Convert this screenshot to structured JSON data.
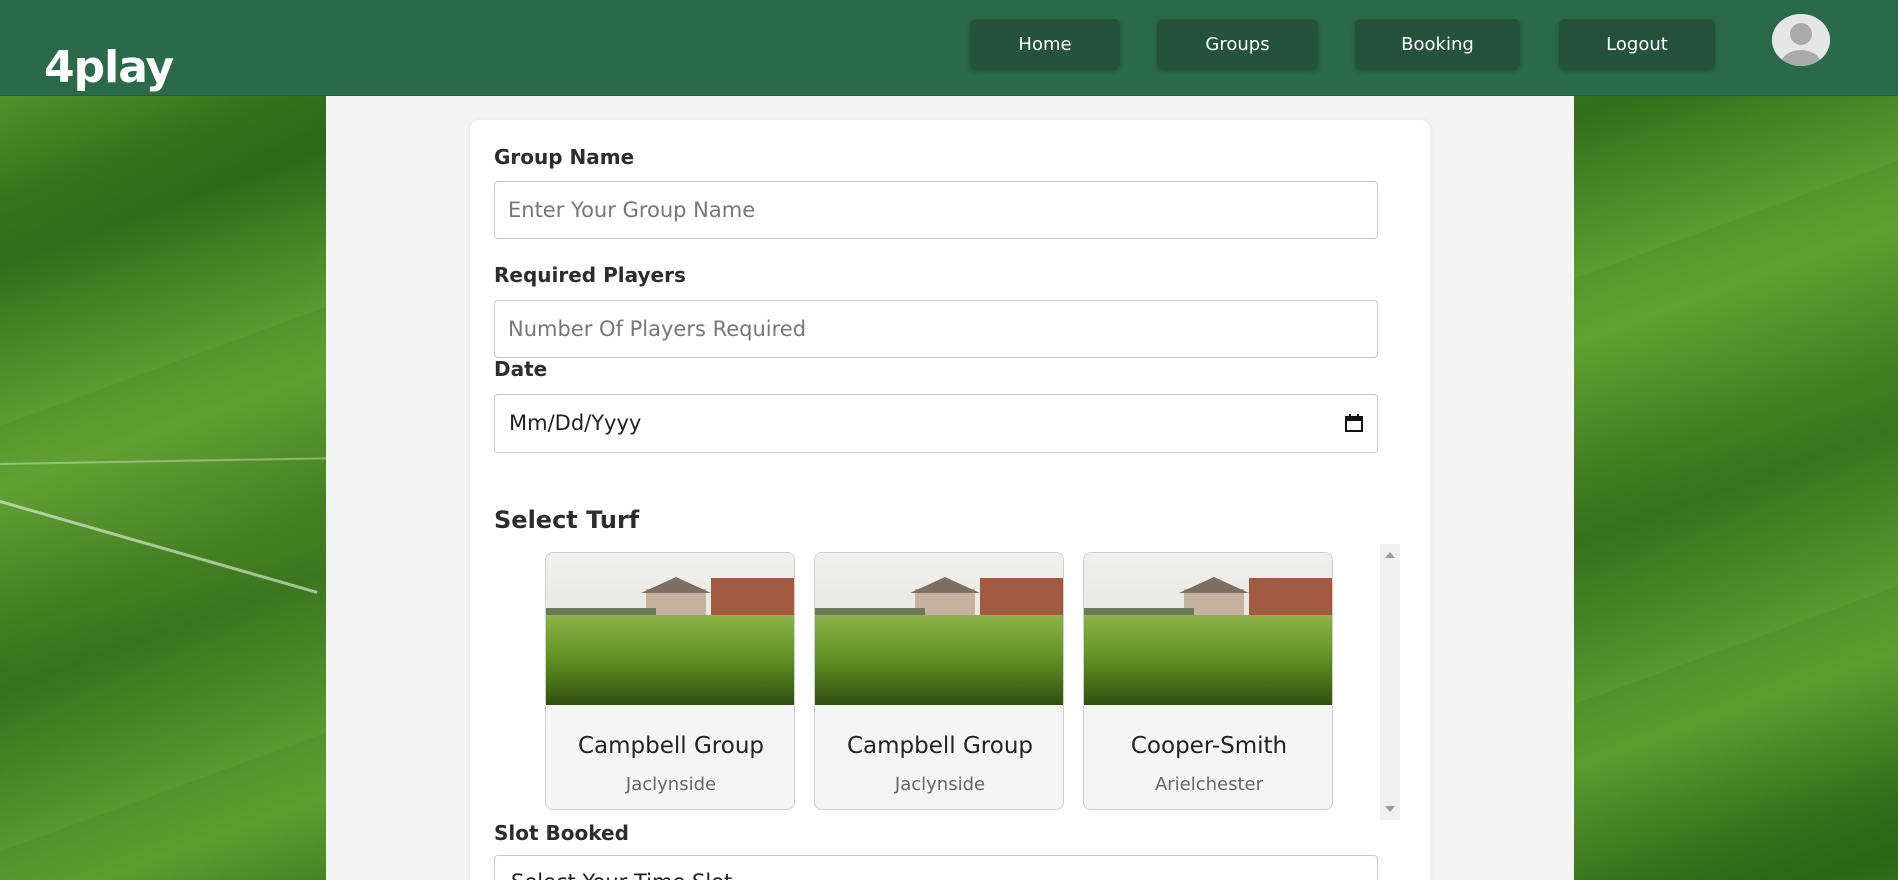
{
  "app": {
    "logo": "4play"
  },
  "nav": {
    "items": [
      {
        "label": "Home"
      },
      {
        "label": "Groups"
      },
      {
        "label": "Booking"
      },
      {
        "label": "Logout"
      }
    ]
  },
  "form": {
    "group_name": {
      "label": "Group Name",
      "placeholder": "Enter Your Group Name"
    },
    "required_players": {
      "label": "Required Players",
      "placeholder": "Number Of Players Required"
    },
    "date": {
      "label": "Date",
      "placeholder": "Mm/Dd/Yyyy"
    },
    "select_turf": {
      "title": "Select Turf"
    },
    "turfs": [
      {
        "name": "Campbell Group",
        "location": "Jaclynside"
      },
      {
        "name": "Campbell Group",
        "location": "Jaclynside"
      },
      {
        "name": "Cooper-Smith",
        "location": "Arielchester"
      }
    ],
    "slot": {
      "label": "Slot Booked",
      "value": "Select Your Time Slot"
    }
  },
  "icons": {
    "avatar": "user-avatar-icon",
    "date": "calendar-icon"
  },
  "colors": {
    "header": "#2a6a48",
    "nav_button": "#24523b"
  }
}
